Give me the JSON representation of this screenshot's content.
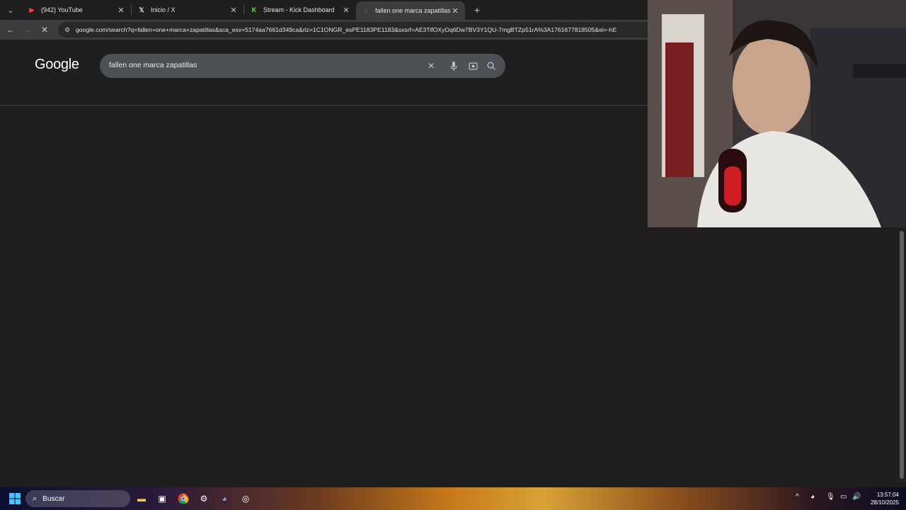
{
  "tabs": [
    {
      "title": "(942) YouTube",
      "icon": "youtube-icon",
      "active": false
    },
    {
      "title": "Inicio / X",
      "icon": "x-icon",
      "active": false
    },
    {
      "title": "Stream - Kick Dashboard",
      "icon": "kick-icon",
      "active": false
    },
    {
      "title": "fallen one marca zapatillas - Bu",
      "icon": "google-icon",
      "active": true
    }
  ],
  "toolbar": {
    "url": "google.com/search?q=fallen+one+marca+zapatillas&sca_esv=5174aa7661d349ca&rlz=1C1ONGR_esPE1183PE1183&sxsrf=AE3TifOXyOq6Dw7BV3Y1QU-7mgBTZp51rA%3A1761677818505&ei=-hE"
  },
  "google": {
    "logo": "Google",
    "query": "fallen one marca zapatillas"
  },
  "taskbar": {
    "search_label": "Buscar",
    "time": "13:57:04",
    "date": "28/10/2025"
  },
  "colors": {
    "accent_red": "#e53935",
    "kick_green": "#53fc18"
  }
}
